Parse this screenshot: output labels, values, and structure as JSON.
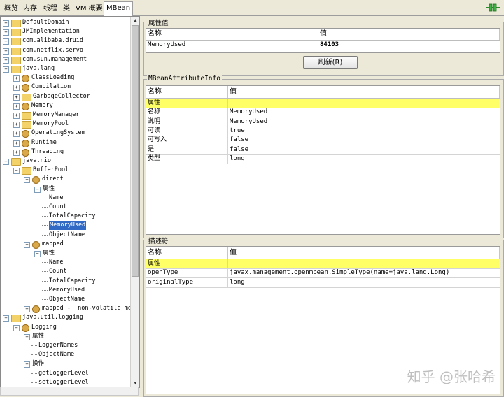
{
  "tabs": [
    "概览",
    "内存",
    "线程",
    "类",
    "VM 概要",
    "MBean"
  ],
  "tree": [
    {
      "label": "DefaultDomain",
      "icon": "folder",
      "level": 0,
      "tog": "+"
    },
    {
      "label": "JMImplementation",
      "icon": "folder",
      "level": 0,
      "tog": "+"
    },
    {
      "label": "com.alibaba.druid",
      "icon": "folder",
      "level": 0,
      "tog": "+"
    },
    {
      "label": "com.netflix.servo",
      "icon": "folder",
      "level": 0,
      "tog": "+"
    },
    {
      "label": "com.sun.management",
      "icon": "folder",
      "level": 0,
      "tog": "+"
    },
    {
      "label": "java.lang",
      "icon": "folder",
      "level": 0,
      "tog": "-"
    },
    {
      "label": "ClassLoading",
      "icon": "bean",
      "level": 1,
      "tog": "+"
    },
    {
      "label": "Compilation",
      "icon": "bean",
      "level": 1,
      "tog": "+"
    },
    {
      "label": "GarbageCollector",
      "icon": "folder",
      "level": 1,
      "tog": "+"
    },
    {
      "label": "Memory",
      "icon": "bean",
      "level": 1,
      "tog": "+"
    },
    {
      "label": "MemoryManager",
      "icon": "folder",
      "level": 1,
      "tog": "+"
    },
    {
      "label": "MemoryPool",
      "icon": "folder",
      "level": 1,
      "tog": "+"
    },
    {
      "label": "OperatingSystem",
      "icon": "bean",
      "level": 1,
      "tog": "+"
    },
    {
      "label": "Runtime",
      "icon": "bean",
      "level": 1,
      "tog": "+"
    },
    {
      "label": "Threading",
      "icon": "bean",
      "level": 1,
      "tog": "+"
    },
    {
      "label": "java.nio",
      "icon": "folder",
      "level": 0,
      "tog": "-"
    },
    {
      "label": "BufferPool",
      "icon": "folder",
      "level": 1,
      "tog": "-"
    },
    {
      "label": "direct",
      "icon": "bean",
      "level": 2,
      "tog": "-"
    },
    {
      "label": "属性",
      "icon": "none",
      "level": 3,
      "tog": "-"
    },
    {
      "label": "Name",
      "icon": "leaf",
      "level": 4,
      "tog": ""
    },
    {
      "label": "Count",
      "icon": "leaf",
      "level": 4,
      "tog": ""
    },
    {
      "label": "TotalCapacity",
      "icon": "leaf",
      "level": 4,
      "tog": ""
    },
    {
      "label": "MemoryUsed",
      "icon": "leaf",
      "level": 4,
      "tog": "",
      "selected": true
    },
    {
      "label": "ObjectName",
      "icon": "leaf",
      "level": 4,
      "tog": ""
    },
    {
      "label": "mapped",
      "icon": "bean",
      "level": 2,
      "tog": "-"
    },
    {
      "label": "属性",
      "icon": "none",
      "level": 3,
      "tog": "-"
    },
    {
      "label": "Name",
      "icon": "leaf",
      "level": 4,
      "tog": ""
    },
    {
      "label": "Count",
      "icon": "leaf",
      "level": 4,
      "tog": ""
    },
    {
      "label": "TotalCapacity",
      "icon": "leaf",
      "level": 4,
      "tog": ""
    },
    {
      "label": "MemoryUsed",
      "icon": "leaf",
      "level": 4,
      "tog": ""
    },
    {
      "label": "ObjectName",
      "icon": "leaf",
      "level": 4,
      "tog": ""
    },
    {
      "label": "mapped - 'non-volatile me",
      "icon": "bean",
      "level": 2,
      "tog": "+"
    },
    {
      "label": "java.util.logging",
      "icon": "folder",
      "level": 0,
      "tog": "-"
    },
    {
      "label": "Logging",
      "icon": "bean",
      "level": 1,
      "tog": "-"
    },
    {
      "label": "属性",
      "icon": "none",
      "level": 2,
      "tog": "-"
    },
    {
      "label": "LoggerNames",
      "icon": "leaf",
      "level": 3,
      "tog": ""
    },
    {
      "label": "ObjectName",
      "icon": "leaf",
      "level": 3,
      "tog": ""
    },
    {
      "label": "操作",
      "icon": "none",
      "level": 2,
      "tog": "-"
    },
    {
      "label": "getLoggerLevel",
      "icon": "leaf",
      "level": 3,
      "tog": ""
    },
    {
      "label": "setLoggerLevel",
      "icon": "leaf",
      "level": 3,
      "tog": ""
    }
  ],
  "attr_values": {
    "title": "属性值",
    "col_name": "名称",
    "col_value": "值",
    "row_name": "MemoryUsed",
    "row_value": "84103",
    "refresh_button": "刷新(R)"
  },
  "attr_info": {
    "title": "MBeanAttributeInfo",
    "col_name": "名称",
    "col_value": "值",
    "rows": [
      {
        "name": "属性",
        "value": "",
        "highlight": true
      },
      {
        "name": "名称",
        "value": "MemoryUsed"
      },
      {
        "name": "说明",
        "value": "MemoryUsed"
      },
      {
        "name": "可读",
        "value": "true"
      },
      {
        "name": "可写入",
        "value": "false"
      },
      {
        "name": "是",
        "value": "false"
      },
      {
        "name": "类型",
        "value": "long"
      }
    ]
  },
  "descriptor": {
    "title": "描述符",
    "col_name": "名称",
    "col_value": "值",
    "rows": [
      {
        "name": "属性",
        "value": "",
        "highlight": true
      },
      {
        "name": "openType",
        "value": "javax.management.openmbean.SimpleType(name=java.lang.Long)"
      },
      {
        "name": "originalType",
        "value": "long"
      }
    ]
  },
  "watermark": "知乎 @张哈希"
}
